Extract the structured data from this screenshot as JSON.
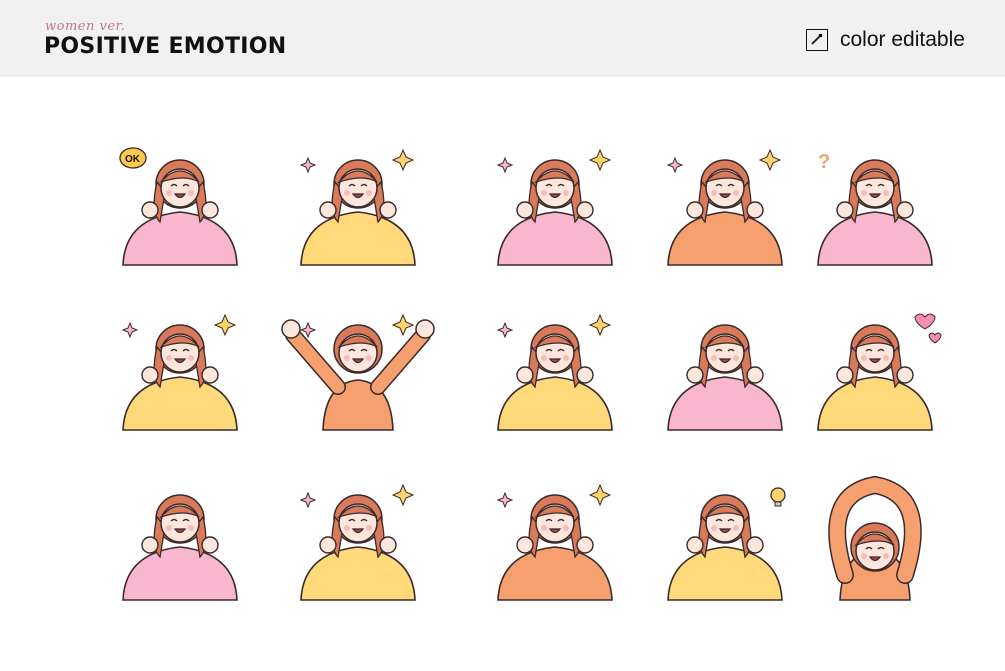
{
  "header": {
    "subtitle": "women ver.",
    "title": "POSITIVE EMOTION",
    "badge_label": "color editable",
    "badge_icon": "eyedropper-icon"
  },
  "colors": {
    "pink": "#f9b6cf",
    "yellow": "#ffd97a",
    "orange": "#f6a070",
    "hair": "#d97a5a",
    "skin": "#fde7dc",
    "outline": "#3a2a2a",
    "header_bg": "#f1f1f1"
  },
  "figures": [
    {
      "shirt": "pink",
      "pose": "ok",
      "accent": "ok-bubble",
      "bubble_text": "OK"
    },
    {
      "shirt": "yellow",
      "pose": "fists",
      "accent": "sparkle"
    },
    {
      "shirt": "pink",
      "pose": "cheeks",
      "accent": "sparkle"
    },
    {
      "shirt": "orange",
      "pose": "mouth",
      "accent": "burst"
    },
    {
      "shirt": "pink",
      "pose": "chin",
      "accent": "question"
    },
    {
      "shirt": "yellow",
      "pose": "heart-hands",
      "accent": "sparkle"
    },
    {
      "shirt": "orange",
      "pose": "cheer",
      "accent": "sparkle"
    },
    {
      "shirt": "yellow",
      "pose": "arms-crossed",
      "accent": "sparkle"
    },
    {
      "shirt": "pink",
      "pose": "hips",
      "accent": "none"
    },
    {
      "shirt": "yellow",
      "pose": "love",
      "accent": "hearts"
    },
    {
      "shirt": "pink",
      "pose": "point",
      "accent": "none"
    },
    {
      "shirt": "yellow",
      "pose": "wave",
      "accent": "star"
    },
    {
      "shirt": "orange",
      "pose": "clap",
      "accent": "sparkle"
    },
    {
      "shirt": "yellow",
      "pose": "idea",
      "accent": "bulb"
    },
    {
      "shirt": "orange",
      "pose": "circle-arms",
      "accent": "none"
    }
  ]
}
